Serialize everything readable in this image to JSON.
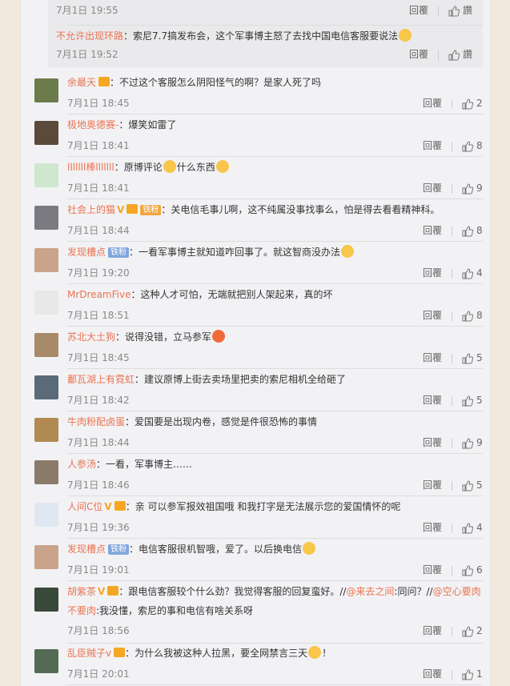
{
  "nested_replies": [
    {
      "name": "",
      "text": "",
      "time": "7月1日 19:55",
      "reply": "回覆",
      "like": "讚"
    },
    {
      "name": "不允许出现环路",
      "text": "：索尼7.7搞发布会，这个军事博主怒了去找中国电信客服要说法",
      "time": "7月1日 19:52",
      "reply": "回覆",
      "like": "讚"
    }
  ],
  "comments": [
    {
      "name": "余最天",
      "badges": [
        "lv"
      ],
      "text": "：不过这个客服怎么阴阳怪气的啊？是家人死了吗",
      "emoji": [],
      "time": "7月1日 18:45",
      "reply": "回覆",
      "likes": "2",
      "avatar": "#6b7b4b"
    },
    {
      "name": "极地奥德赛-",
      "badges": [],
      "text": "：爆笑如雷了",
      "emoji": [],
      "time": "7月1日 18:41",
      "reply": "回覆",
      "likes": "8",
      "avatar": "#5b4a3a"
    },
    {
      "name": "lllllll棒lllllll",
      "badges": [],
      "text": "：原博评论",
      "text2": "什么东西",
      "time": "7月1日 18:41",
      "reply": "回覆",
      "likes": "9",
      "avatar": "#cfe6cf"
    },
    {
      "name": "社会上的猫",
      "badges": [
        "v",
        "lv",
        "gold"
      ],
      "fan_label": "铁粉",
      "text": "：关电信毛事儿啊，这不纯属没事找事么，怕是得去看看精神科。",
      "time": "7月1日 18:44",
      "reply": "回覆",
      "likes": "8",
      "avatar": "#7a7a80"
    },
    {
      "name": "发现槽点",
      "badges": [
        "fan"
      ],
      "fan_label": "铁粉",
      "text": "：一看军事博主就知道咋回事了。就这智商没办法",
      "time": "7月1日 19:20",
      "reply": "回覆",
      "likes": "4",
      "avatar": "#c9a38a"
    },
    {
      "name": "MrDreamFive",
      "badges": [],
      "text": "：这种人才可怕，无端就把别人架起来，真的坏",
      "time": "7月1日 18:51",
      "reply": "回覆",
      "likes": "8",
      "avatar": "#e8e8e8"
    },
    {
      "name": "苏北大土狗",
      "badges": [],
      "text": "：说得没错，立马参军",
      "time": "7月1日 18:45",
      "reply": "回覆",
      "likes": "5",
      "avatar": "#a88a6a"
    },
    {
      "name": "鄱瓦湖上有霓虹",
      "badges": [],
      "text": "：建议原博上街去卖场里把卖的索尼相机全给砸了",
      "time": "7月1日 18:42",
      "reply": "回覆",
      "likes": "5",
      "avatar": "#5a6a78"
    },
    {
      "name": "牛肉粉配卤蛋",
      "badges": [],
      "text": "：爱国要是出现内卷，感觉是件很恐怖的事情",
      "time": "7月1日 18:44",
      "reply": "回覆",
      "likes": "9",
      "avatar": "#b08a50"
    },
    {
      "name": "人参汤",
      "badges": [],
      "text": "：一看，军事博主……",
      "time": "7月1日 18:46",
      "reply": "回覆",
      "likes": "5",
      "avatar": "#8a7a6a"
    },
    {
      "name": "人间C位",
      "badges": [
        "v",
        "lv"
      ],
      "text": "：亲 可以参军报效祖国哦 和我打字是无法展示您的爱国情怀的呢",
      "time": "7月1日 19:36",
      "reply": "回覆",
      "likes": "4",
      "avatar": "#dfe8f0"
    },
    {
      "name": "发现槽点",
      "badges": [
        "fan"
      ],
      "fan_label": "铁粉",
      "text": "：电信客服很机智哦，爱了。以后换电信",
      "time": "7月1日 19:01",
      "reply": "回覆",
      "likes": "6",
      "avatar": "#c9a38a"
    },
    {
      "name": "胡紫茶",
      "badges": [
        "v",
        "lv"
      ],
      "text": "：跟电信客服较个什么劲？我觉得客服的回复蛮好。//",
      "mention1": "@来去之间",
      "mid": ":同问？//",
      "mention2": "@空心要肉不要肉",
      "tail": ":我没懂，索尼的事和电信有啥关系呀",
      "time": "7月1日 18:56",
      "reply": "回覆",
      "likes": "2",
      "avatar": "#3a4a3a"
    },
    {
      "name": "乱臣贼子v",
      "badges": [
        "lv"
      ],
      "text": "：为什么我被这种人拉黑，要全网禁言三天",
      "tail": "！",
      "time": "7月1日 20:01",
      "reply": "回覆",
      "likes": "1",
      "avatar": "#556a55"
    }
  ]
}
